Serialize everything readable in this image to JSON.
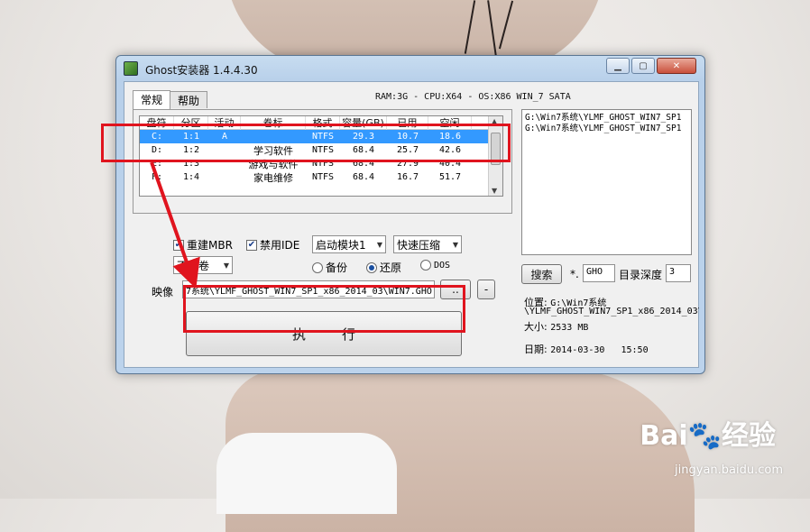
{
  "window": {
    "title": "Ghost安装器 1.4.4.30"
  },
  "tabs": [
    {
      "label": "常规"
    },
    {
      "label": "帮助"
    }
  ],
  "sysinfo": "RAM:3G - CPU:X64 - OS:X86 WIN_7 SATA",
  "disk_table": {
    "headers": [
      "盘符",
      "分区",
      "活动",
      "卷标",
      "格式",
      "容量(GB)",
      "已用",
      "空闲"
    ],
    "rows": [
      [
        "C:",
        "1:1",
        "A",
        "",
        "NTFS",
        "29.3",
        "10.7",
        "18.6"
      ],
      [
        "D:",
        "1:2",
        "",
        "学习软件",
        "NTFS",
        "68.4",
        "25.7",
        "42.6"
      ],
      [
        "E:",
        "1:3",
        "",
        "游戏与软件",
        "NTFS",
        "68.4",
        "27.9",
        "40.4"
      ],
      [
        "F:",
        "1:4",
        "",
        "家电维修",
        "NTFS",
        "68.4",
        "16.7",
        "51.7"
      ]
    ],
    "selected_index": 0
  },
  "options": {
    "rebuild_mbr": {
      "label": "重建MBR",
      "checked": true
    },
    "disable_ide": {
      "label": "禁用IDE",
      "checked": true
    },
    "boot_module": "启动模块1",
    "compression": "快速压缩",
    "split": "不分卷",
    "mode": {
      "backup": "备份",
      "restore": "还原",
      "dos": "DOS",
      "selected": "restore"
    }
  },
  "image": {
    "label": "映像",
    "path": "7系统\\YLMF_GHOST_WIN7_SP1_x86_2014_03\\WIN7.GHO",
    "browse_label": "..",
    "remove_label": "-"
  },
  "execute_label": "执行",
  "right_panel": {
    "files": [
      "G:\\Win7系统\\YLMF_GHOST_WIN7_SP1",
      "G:\\Win7系统\\YLMF_GHOST_WIN7_SP1"
    ],
    "search_label": "搜索",
    "ext_prefix": "*.",
    "ext_value": "GHO",
    "depth_label": "目录深度",
    "depth_value": "3",
    "location_label": "位置:",
    "location_line1": "G:\\Win7系统",
    "location_line2": "\\YLMF_GHOST_WIN7_SP1_x86_2014_03\\",
    "size_label": "大小:",
    "size_value": "2533 MB",
    "date_label": "日期:",
    "date_value": "2014-03-30   15:50"
  },
  "watermark": {
    "brand": "Bai",
    "brand2": "经验",
    "url": "jingyan.baidu.com"
  },
  "colors": {
    "selection": "#3399ff",
    "annotation": "#e0141e"
  }
}
